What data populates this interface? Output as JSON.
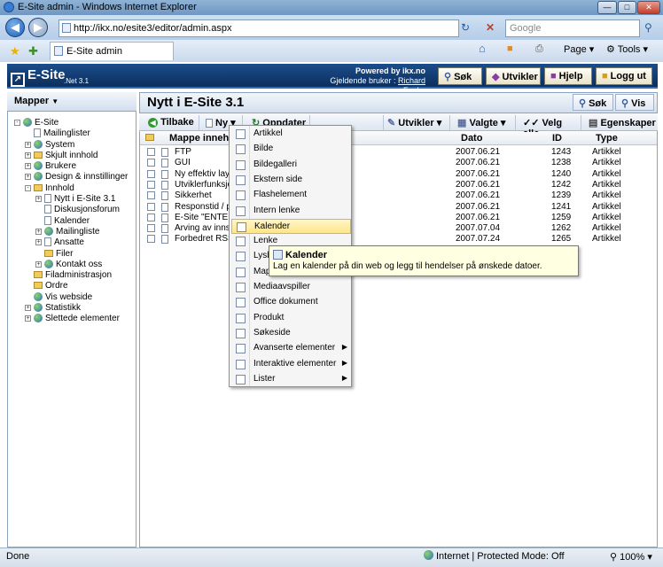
{
  "browser": {
    "title": "E-Site admin - Windows Internet Explorer",
    "url": "http://ikx.no/esite3/editor/admin.aspx",
    "search_placeholder": "Google",
    "tab_title": "E-Site admin",
    "cmd_page": "Page",
    "cmd_tools": "Tools"
  },
  "header": {
    "logo": "E-Site",
    "version": ".Net 3.1",
    "powered": "Powered by ikx.no",
    "current_user_label": "Gjeldende bruker :",
    "current_user": "Richard Funke",
    "buttons": {
      "search": "Søk",
      "developer": "Utvikler",
      "help": "Hjelp",
      "logout": "Logg ut"
    }
  },
  "sidebar": {
    "title": "Mapper",
    "tree": [
      {
        "label": "E-Site",
        "level": 0,
        "toggle": "-",
        "icon": "globe-icon"
      },
      {
        "label": "Mailinglister",
        "level": 1,
        "toggle": "",
        "icon": "page-icon"
      },
      {
        "label": "System",
        "level": 1,
        "toggle": "+",
        "icon": "globe-icon"
      },
      {
        "label": "Skjult innhold",
        "level": 1,
        "toggle": "+",
        "icon": "folder-icon"
      },
      {
        "label": "Brukere",
        "level": 1,
        "toggle": "+",
        "icon": "users-icon"
      },
      {
        "label": "Design & innstillinger",
        "level": 1,
        "toggle": "+",
        "icon": "settings-icon"
      },
      {
        "label": "Innhold",
        "level": 1,
        "toggle": "-",
        "icon": "folder-icon"
      },
      {
        "label": "Nytt i E-Site 3.1",
        "level": 2,
        "toggle": "+",
        "icon": "page-icon"
      },
      {
        "label": "Diskusjonsforum",
        "level": 2,
        "toggle": "",
        "icon": "page-icon"
      },
      {
        "label": "Kalender",
        "level": 2,
        "toggle": "",
        "icon": "calendar-icon"
      },
      {
        "label": "Mailingliste",
        "level": 2,
        "toggle": "+",
        "icon": "globe-icon"
      },
      {
        "label": "Ansatte",
        "level": 2,
        "toggle": "+",
        "icon": "page-icon"
      },
      {
        "label": "Filer",
        "level": 2,
        "toggle": "",
        "icon": "folder-icon"
      },
      {
        "label": "Kontakt oss",
        "level": 2,
        "toggle": "+",
        "icon": "globe-icon"
      },
      {
        "label": "Filadministrasjon",
        "level": 1,
        "toggle": "",
        "icon": "folder-icon"
      },
      {
        "label": "Ordre",
        "level": 1,
        "toggle": "",
        "icon": "folder-icon"
      },
      {
        "label": "Vis webside",
        "level": 1,
        "toggle": "",
        "icon": "globe-icon"
      },
      {
        "label": "Statistikk",
        "level": 1,
        "toggle": "+",
        "icon": "globe-icon"
      },
      {
        "label": "Slettede elementer",
        "level": 1,
        "toggle": "+",
        "icon": "globe-icon"
      }
    ]
  },
  "main": {
    "title": "Nytt i E-Site 3.1",
    "head_buttons": {
      "search": "Søk",
      "view": "Vis"
    },
    "toolbar": {
      "back": "Tilbake",
      "new": "Ny",
      "update": "Oppdater",
      "developer": "Utvikler",
      "selected": "Valgte",
      "select_all": "Velg alle",
      "properties": "Egenskaper"
    },
    "columns": {
      "name": "Mappe innehold",
      "date": "Dato",
      "id": "ID",
      "type": "Type"
    },
    "rows": [
      {
        "name": "FTP",
        "date": "2007.06.21",
        "id": "1243",
        "type": "Artikkel"
      },
      {
        "name": "GUI",
        "date": "2007.06.21",
        "id": "1238",
        "type": "Artikkel"
      },
      {
        "name": "Ny effektiv layo",
        "date": "2007.06.21",
        "id": "1240",
        "type": "Artikkel"
      },
      {
        "name": "Utviklerfunksjo",
        "date": "2007.06.21",
        "id": "1242",
        "type": "Artikkel"
      },
      {
        "name": "Sikkerhet",
        "date": "2007.06.21",
        "id": "1239",
        "type": "Artikkel"
      },
      {
        "name": "Responstid / p",
        "date": "2007.06.21",
        "id": "1241",
        "type": "Artikkel"
      },
      {
        "name": "E-Site \"ENTER",
        "date": "2007.06.21",
        "id": "1259",
        "type": "Artikkel"
      },
      {
        "name": "Arving av innst",
        "date": "2007.07.04",
        "id": "1262",
        "type": "Artikkel"
      },
      {
        "name": "Forbedret RSS",
        "date": "2007.07.24",
        "id": "1265",
        "type": "Artikkel"
      }
    ]
  },
  "new_menu": {
    "items": [
      {
        "label": "Artikkel",
        "submenu": false
      },
      {
        "label": "Bilde",
        "submenu": false
      },
      {
        "label": "Bildegalleri",
        "submenu": false
      },
      {
        "label": "Ekstern side",
        "submenu": false
      },
      {
        "label": "Flashelement",
        "submenu": false
      },
      {
        "label": "Intern lenke",
        "submenu": false
      },
      {
        "label": "Kalender",
        "submenu": false,
        "selected": true
      },
      {
        "label": "Lenke",
        "submenu": false
      },
      {
        "label": "Lysb",
        "submenu": false
      },
      {
        "label": "Map",
        "submenu": false
      },
      {
        "label": "Mediaavspiller",
        "submenu": false
      },
      {
        "label": "Office dokument",
        "submenu": false
      },
      {
        "label": "Produkt",
        "submenu": false
      },
      {
        "label": "Søkeside",
        "submenu": false
      },
      {
        "label": "Avanserte elementer",
        "submenu": true
      },
      {
        "label": "Interaktive elementer",
        "submenu": true
      },
      {
        "label": "Lister",
        "submenu": true
      }
    ]
  },
  "tooltip": {
    "title": "Kalender",
    "text": "Lag en kalender på din web og legg til hendelser på ønskede datoer."
  },
  "status": {
    "left": "Done",
    "zone": "Internet | Protected Mode: Off",
    "zoom": "100%"
  }
}
